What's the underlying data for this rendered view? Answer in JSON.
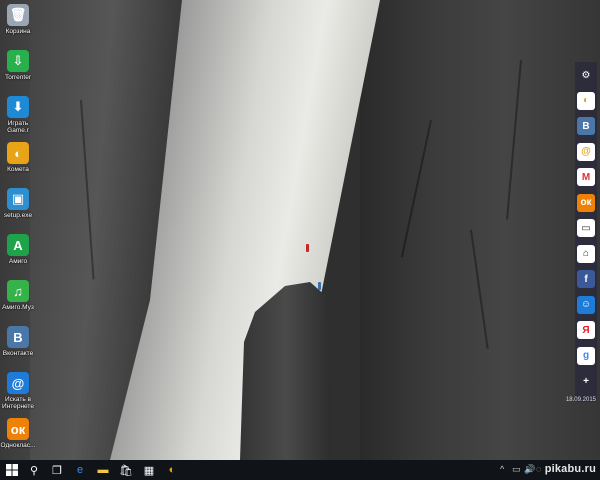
{
  "desktop": {
    "icons": [
      {
        "label": "Корзина",
        "icon": "recycle-bin-icon",
        "color": "#9aa6b2",
        "glyph": "🗑"
      },
      {
        "label": "Torrenter",
        "icon": "torrent-icon",
        "color": "#27b04b",
        "glyph": "⇩"
      },
      {
        "label": "Играть Game.r",
        "icon": "game-download-icon",
        "color": "#1e8ad6",
        "glyph": "⬇"
      },
      {
        "label": "Комета",
        "icon": "kometa-browser-icon",
        "color": "#e8a317",
        "glyph": "◐"
      },
      {
        "label": "setup.exe",
        "icon": "setup-box-icon",
        "color": "#2d8fcf",
        "glyph": "▣"
      },
      {
        "label": "Амиго",
        "icon": "amigo-browser-icon",
        "color": "#1fa34a",
        "glyph": "A"
      },
      {
        "label": "Амиго.Муз",
        "icon": "amigo-music-icon",
        "color": "#35b24a",
        "glyph": "♫"
      },
      {
        "label": "Вконтакте",
        "icon": "vk-icon",
        "color": "#4a76a8",
        "glyph": "B"
      },
      {
        "label": "Искать в Интернете",
        "icon": "mail-search-icon",
        "color": "#1e7bd8",
        "glyph": "@"
      },
      {
        "label": "Одноклас...",
        "icon": "odnoklassniki-icon",
        "color": "#ee8208",
        "glyph": "ок"
      }
    ]
  },
  "quickbar": {
    "items": [
      {
        "icon": "settings-icon",
        "color": "transparent",
        "glyph": "⚙"
      },
      {
        "icon": "kometa-icon",
        "color": "#ffffff",
        "glyph": "◐"
      },
      {
        "icon": "vk-icon",
        "color": "#4a76a8",
        "glyph": "B"
      },
      {
        "icon": "mail-ru-icon",
        "color": "#ffffff",
        "glyph": "@"
      },
      {
        "icon": "gmail-icon",
        "color": "#ffffff",
        "glyph": "M"
      },
      {
        "icon": "odnoklassniki-icon",
        "color": "#ee8208",
        "glyph": "ок"
      },
      {
        "icon": "window-icon",
        "color": "#ffffff",
        "glyph": "▭"
      },
      {
        "icon": "home-icon",
        "color": "#ffffff",
        "glyph": "⌂"
      },
      {
        "icon": "facebook-icon",
        "color": "#3b5998",
        "glyph": "f"
      },
      {
        "icon": "moy-mir-icon",
        "color": "#1e7bd8",
        "glyph": "☺"
      },
      {
        "icon": "yandex-icon",
        "color": "#ffffff",
        "glyph": "Я"
      },
      {
        "icon": "google-icon",
        "color": "#ffffff",
        "glyph": "g"
      },
      {
        "icon": "add-icon",
        "color": "transparent",
        "glyph": "+"
      }
    ],
    "date": "18.09.2015"
  },
  "taskbar": {
    "start_icon": "windows-start-icon",
    "pinned": [
      {
        "icon": "search-icon",
        "glyph": "⚲"
      },
      {
        "icon": "task-view-icon",
        "glyph": "❐"
      },
      {
        "icon": "edge-browser-icon",
        "glyph": "e"
      },
      {
        "icon": "file-explorer-icon",
        "glyph": "▬"
      },
      {
        "icon": "store-icon",
        "glyph": "🛍"
      },
      {
        "icon": "media-app-icon",
        "glyph": "▦"
      },
      {
        "icon": "kometa-taskbar-icon",
        "glyph": "◐"
      }
    ],
    "tray": [
      "^",
      "▭",
      "🔊",
      "◌"
    ],
    "watermark": "pikabu.ru"
  }
}
